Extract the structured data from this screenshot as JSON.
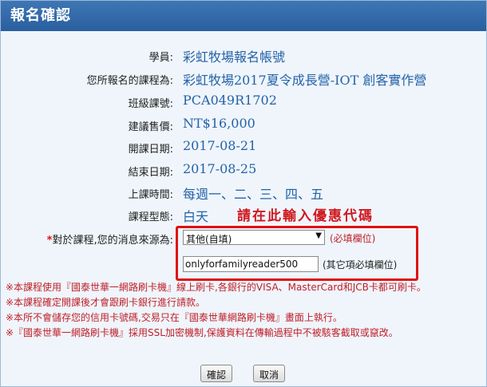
{
  "header": {
    "title": "報名確認"
  },
  "fields": [
    {
      "label": "學員:",
      "value": "彩虹牧場報名帳號"
    },
    {
      "label": "您所報名的課程為:",
      "value": "彩虹牧場2017夏令成長營-IOT 創客實作營"
    },
    {
      "label": "班級課號:",
      "value": "PCA049R1702"
    },
    {
      "label": "建議售價:",
      "value": "NT$16,000"
    },
    {
      "label": "開課日期:",
      "value": "2017-08-21"
    },
    {
      "label": "結束日期:",
      "value": "2017-08-25"
    },
    {
      "label": "上課時間:",
      "value": "每週一、二、三、四、五"
    },
    {
      "label": "課程型態:",
      "value": "白天"
    }
  ],
  "source": {
    "required_star": "*",
    "label": "對於課程,您的消息來源為:",
    "selected_option": "其他(自填)",
    "required_note": "(必填欄位)",
    "other_value": "onlyforfamilyreader500",
    "other_note": "(其它項必填欄位)"
  },
  "promo_hint": "請在此輸入優惠代碼",
  "notes": [
    "※本課程使用『國泰世華一網路刷卡機』線上刷卡,各銀行的VISA、MasterCard和JCB卡都可刷卡。",
    "※本課程確定開課後才會跟刷卡銀行進行請款。",
    "※本所不會儲存您的信用卡號碼,交易只在『國泰世華網路刷卡機』畫面上執行。",
    "※『國泰世華一網路刷卡機』採用SSL加密機制,保護資料在傳輸過程中不被駭客截取或竄改。"
  ],
  "buttons": {
    "confirm": "確認",
    "cancel": "取消"
  },
  "colors": {
    "header": "#2f66a7",
    "value_text": "#2462a8",
    "note_text": "#c0202a",
    "highlight_box": "#e01010"
  }
}
